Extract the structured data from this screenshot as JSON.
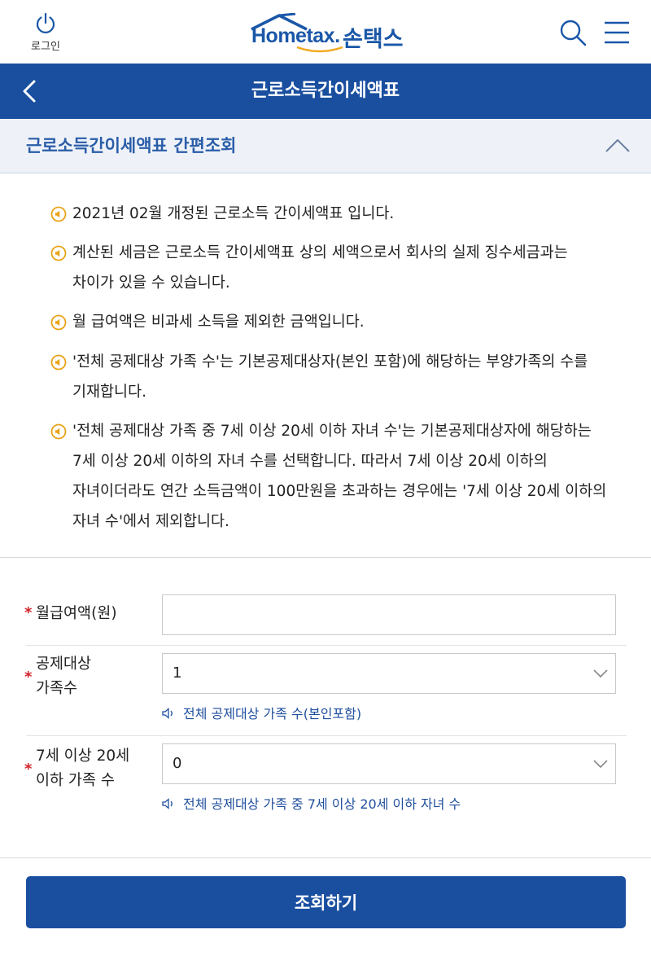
{
  "header": {
    "login_label": "로그인",
    "logo_brand": "Hometax.",
    "logo_sub": "손택스"
  },
  "titlebar": {
    "title": "근로소득간이세액표"
  },
  "section": {
    "title": "근로소득간이세액표 간편조회"
  },
  "notices": [
    "2021년 02월 개정된 근로소득 간이세액표 입니다.",
    "계산된 세금은 근로소득 간이세액표 상의 세액으로서 회사의 실제 징수세금과는 차이가 있을 수 있습니다.",
    "월 급여액은 비과세 소득을 제외한 금액입니다.",
    "'전체 공제대상 가족 수'는 기본공제대상자(본인 포함)에 해당하는 부양가족의 수를 기재합니다.",
    "'전체 공제대상 가족 중 7세 이상 20세 이하 자녀 수'는 기본공제대상자에 해당하는 7세 이상 20세 이하의 자녀 수를 선택합니다. 따라서 7세 이상 20세 이하의 자녀이더라도 연간 소득금액이 100만원을 초과하는 경우에는 '7세 이상 20세 이하의 자녀 수'에서 제외합니다."
  ],
  "form": {
    "required_mark": "*",
    "salary": {
      "label": "월급여액(원)",
      "value": ""
    },
    "family": {
      "label": "공제대상 가족수",
      "value": "1",
      "hint": "전체 공제대상 가족 수(본인포함)"
    },
    "children": {
      "label": "7세 이상 20세 이하 가족 수",
      "value": "0",
      "hint": "전체 공제대상 가족 중 7세 이상 20세 이하 자녀 수"
    }
  },
  "submit": {
    "label": "조회하기"
  },
  "colors": {
    "primary": "#1a4fa0",
    "section_text": "#2a5da8",
    "bullet": "#e8a317",
    "required": "#d2232a"
  }
}
